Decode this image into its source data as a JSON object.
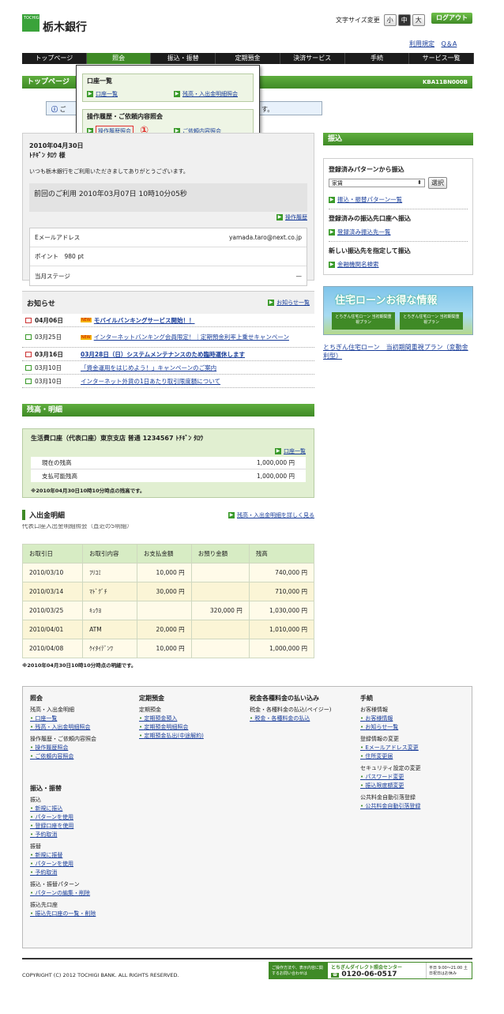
{
  "header": {
    "logo_text": "TOCHIGIN",
    "bank_name": "栃木銀行",
    "font_size_label": "文字サイズ変更",
    "font_sizes": [
      "小",
      "中",
      "大"
    ],
    "logout": "ログアウト",
    "links": [
      "利用規定",
      "Q＆A"
    ]
  },
  "nav": [
    "トップページ",
    "照会",
    "振込・振替",
    "定期預金",
    "決済サービス",
    "手続",
    "サービス一覧"
  ],
  "dropdown": {
    "sec1_title": "口座一覧",
    "sec1_links": [
      "口座一覧",
      "残高・入出金明細照会"
    ],
    "sec2_title": "操作履歴・ご依頼内容照会",
    "sec2_links": [
      "操作履歴照会",
      "ご依頼内容照会"
    ],
    "circle": "①"
  },
  "page": {
    "title": "トップページ",
    "code": "KBA11BN000B",
    "notice": "ご",
    "notice_tail": "す。"
  },
  "welcome": {
    "datetime": "2010年04月30日",
    "name": "ﾄﾁｷﾞﾝ ﾀﾛｳ 様",
    "greeting": "いつも栃木銀行をご利用いただきましてありがとうございます。",
    "last_use": "前回のご利用 2010年03月07日 10時10分05秒",
    "history_link": "操作履歴",
    "email_label": "Eメールアドレス",
    "email": "yamada.taro@next.co.jp",
    "point_label": "ポイント　980 pt",
    "stage_label": "当月ステージ",
    "stage_value": "—"
  },
  "transfer": {
    "title": "振込",
    "pattern_title": "登録済みパターンから振込",
    "select_value": "家賃",
    "select_btn": "選択",
    "pattern_link": "振込・振替パターン一覧",
    "reg_title": "登録済みの振込先口座へ振込",
    "reg_link": "登録済み振込先一覧",
    "new_title": "新しい振込先を指定して振込",
    "new_link": "金融機関名検索"
  },
  "banner": {
    "title": "住宅ローンお得な情報",
    "sub1": "とちぎん住宅ローン 当初期間重視プラン",
    "sub2": "とちぎん住宅ローン 当初期間重視プラン",
    "caption": "とちぎん住宅ローン　当初期間重視プラン（変動金利型）"
  },
  "news": {
    "title": "お知らせ",
    "more": "お知らせ一覧",
    "items": [
      {
        "date": "04月06日",
        "new": true,
        "text": "モバイルバンキングサービス開始！！",
        "bold": true
      },
      {
        "date": "03月25日",
        "new": true,
        "text": "インターネットバンキング会員限定！｜定期預金利率上乗せキャンペーン",
        "bold": false
      },
      {
        "date": "03月16日",
        "new": false,
        "text": "03月28日（日）システムメンテナンスのため臨時運休します",
        "bold": true
      },
      {
        "date": "03月10日",
        "new": false,
        "text": "「資金運用をはじめよう！」キャンペーンのご案内",
        "bold": false
      },
      {
        "date": "03月10日",
        "new": false,
        "text": "インターネット外貨の1日あたり取引限度額について",
        "bold": false
      }
    ]
  },
  "balance": {
    "title": "残高・明細",
    "account": "生活費口座（代表口座）東京支店 普通 1234567 ﾄﾁｷﾞﾝ ﾀﾛｳ",
    "list_link": "口座一覧",
    "current_label": "現在の残高",
    "current": "1,000,000 円",
    "available_label": "支払可能残高",
    "available": "1,000,000 円",
    "note": "※2010年04月30日10時10分時点の残高です。"
  },
  "history": {
    "title": "入出金明細",
    "link": "残高・入出金明細を詳しく見る",
    "subtitle": "代表口座入出金明細照会（直近の5明細）",
    "headers": [
      "お取引日",
      "お取引内容",
      "お支払金額",
      "お預り金額",
      "残高"
    ],
    "rows": [
      [
        "2010/03/10",
        "ﾌﾘｺﾐ",
        "10,000 円",
        "",
        "740,000 円"
      ],
      [
        "2010/03/14",
        "ﾏﾄﾞｸﾞﾁ",
        "30,000 円",
        "",
        "710,000 円"
      ],
      [
        "2010/03/25",
        "ｷｭｳﾖ",
        "",
        "320,000 円",
        "1,030,000 円"
      ],
      [
        "2010/04/01",
        "ATM",
        "20,000 円",
        "",
        "1,010,000 円"
      ],
      [
        "2010/04/08",
        "ｹｲﾀｲﾃﾞﾝﾜ",
        "10,000 円",
        "",
        "1,000,000 円"
      ]
    ],
    "note": "※2010年04月30日10時10分時点の明細です。"
  },
  "footer": {
    "col1": {
      "h": "照会",
      "groups": [
        {
          "t": "残高・入出金明細",
          "items": [
            "口座一覧",
            "残高・入出金明細照会"
          ]
        },
        {
          "t": "操作履歴・ご依頼内容照会",
          "items": [
            "操作履歴照会",
            "ご依頼内容照会"
          ]
        }
      ]
    },
    "col1b": {
      "h": "振込・振替",
      "groups": [
        {
          "t": "振込",
          "items": [
            "新規に振込",
            "パターンを使用",
            "登録口座を使用",
            "予約取消"
          ]
        },
        {
          "t": "振替",
          "items": [
            "新規に振替",
            "パターンを使用",
            "予約取消"
          ]
        },
        {
          "t": "振込・振替パターン",
          "items": [
            "パターンの編集・削除"
          ]
        },
        {
          "t": "振込先口座",
          "items": [
            "振込先口座の一覧・削除"
          ]
        }
      ]
    },
    "col2": {
      "h": "定期預金",
      "groups": [
        {
          "t": "定期預金",
          "items": [
            "定期預金預入",
            "定期預金明細照会",
            "定期預金払出(中途解約)"
          ]
        }
      ]
    },
    "col3": {
      "h": "税金各種料金の払い込み",
      "groups": [
        {
          "t": "税金・各種料金の払込(ペイジー)",
          "items": [
            "税金・各種料金の払込"
          ]
        }
      ]
    },
    "col4": {
      "h": "手続",
      "groups": [
        {
          "t": "お客様情報",
          "items": [
            "お客様情報",
            "お知らせ一覧"
          ]
        },
        {
          "t": "登録情報の変更",
          "items": [
            "Eメールアドレス変更",
            "住所変更届"
          ]
        },
        {
          "t": "セキュリティ設定の変更",
          "items": [
            "パスワード変更",
            "振込限度額変更"
          ]
        },
        {
          "t": "公共料金自動引落登録",
          "items": [
            "公共料金自動引落登録"
          ]
        }
      ]
    },
    "copyright": "COPYRIGHT (C) 2012 TOCHIGI BANK. ALL RIGHTS RESERVED.",
    "contact_left": "ご操作方法や、表示内容に関するお問い合わせは",
    "contact_center": "とちぎんダイレクト照会センター",
    "phone": "0120-06-0517",
    "hours": "平日 9:00〜21:00 土日祝日はお休み"
  }
}
